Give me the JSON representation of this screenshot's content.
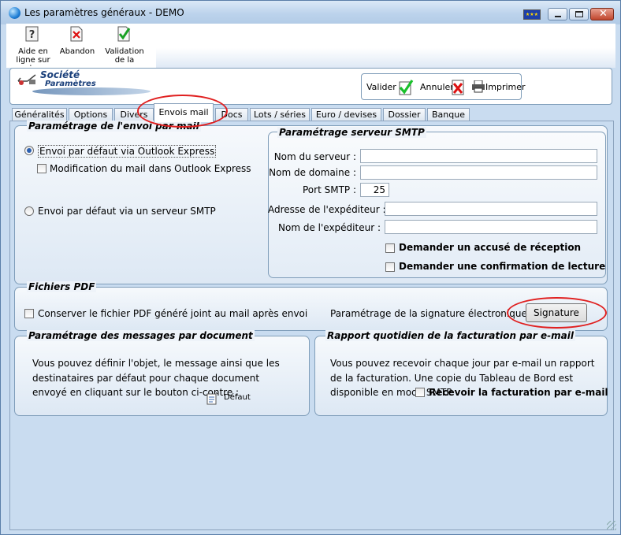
{
  "window": {
    "title": "Les paramètres généraux - DEMO"
  },
  "toolbar": {
    "help": {
      "label": "Aide en\nligne sur le",
      "icon": "help-icon"
    },
    "abandon": {
      "label": "Abandon",
      "icon": "abandon-icon"
    },
    "validate": {
      "label": "Validation\nde la",
      "icon": "validate-checkmark-icon"
    }
  },
  "header": {
    "logo_line1": "Société",
    "logo_line2": "Paramètres",
    "valider": "Valider",
    "annuler": "Annuler",
    "imprimer": "Imprimer"
  },
  "tabs": [
    "Généralités",
    "Options",
    "Divers",
    "Envois mail",
    "Docs",
    "Lots / séries",
    "Euro / devises",
    "Dossier",
    "Banque"
  ],
  "active_tab": "Envois mail",
  "mail": {
    "title": "Paramétrage de l'envoi par mail",
    "radio_outlook": "Envoi par défaut via Outlook Express",
    "chk_modif": "Modification du mail dans Outlook Express",
    "radio_smtp": "Envoi par défaut via un serveur SMTP",
    "selected": "outlook"
  },
  "smtp": {
    "title": "Paramétrage serveur SMTP",
    "server_label": "Nom du serveur :",
    "server_value": "",
    "domain_label": "Nom de domaine :",
    "domain_value": "",
    "port_label": "Port SMTP :",
    "port_value": "25",
    "sender_addr_label": "Adresse de l'expéditeur :",
    "sender_addr_value": "",
    "sender_name_label": "Nom de l'expéditeur :",
    "sender_name_value": "",
    "chk_receipt": "Demander un accusé de réception",
    "chk_read": "Demander une confirmation de lecture"
  },
  "pdf": {
    "title": "Fichiers PDF",
    "chk_keep": "Conserver le fichier PDF généré joint au mail après envoi",
    "sig_label": "Paramétrage de la signature électronique :",
    "sig_button": "Signature"
  },
  "messages": {
    "title": "Paramétrage des messages par document",
    "text": "Vous pouvez définir l'objet, le message ainsi que les destinataires par défaut pour chaque document envoyé en cliquant sur le bouton ci-contre :",
    "default_button": "Défaut"
  },
  "report": {
    "title": "Rapport quotidien de la facturation par e-mail",
    "text": "Vous pouvez recevoir chaque jour par e-mail un rapport de la facturation. Une copie du Tableau de Bord est disponible en mode SMTP.",
    "chk_receive": "Recevoir la facturation par e-mail"
  },
  "colors": {
    "accent": "#2a5fb0",
    "highlight_oval": "#e02020",
    "panel_bg": "#c9dcf0"
  }
}
